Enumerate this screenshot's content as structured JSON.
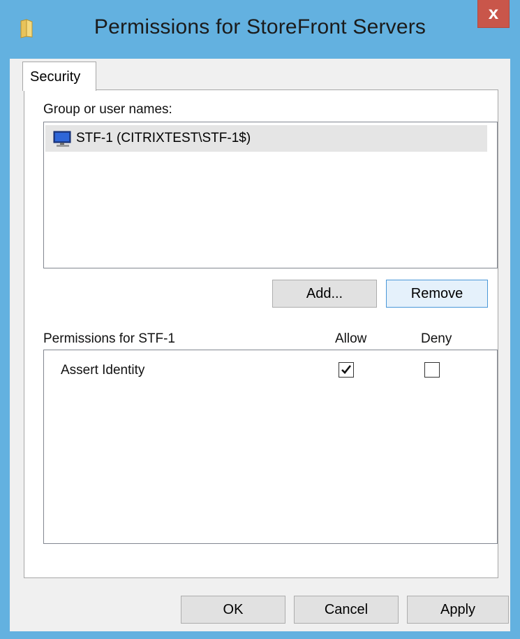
{
  "window": {
    "title": "Permissions for StoreFront Servers",
    "close_glyph": "x"
  },
  "tabs": [
    {
      "label": "Security",
      "active": true
    }
  ],
  "group_section": {
    "label": "Group or user names:",
    "items": [
      {
        "icon": "computer-icon",
        "name": "STF-1 (CITRIXTEST\\STF-1$)",
        "selected": true
      }
    ]
  },
  "group_buttons": {
    "add": "Add...",
    "remove": "Remove"
  },
  "permissions": {
    "header_label": "Permissions for STF-1",
    "allow_header": "Allow",
    "deny_header": "Deny",
    "rows": [
      {
        "name": "Assert Identity",
        "allow": true,
        "deny": false
      }
    ]
  },
  "footer_buttons": {
    "ok": "OK",
    "cancel": "Cancel",
    "apply": "Apply"
  },
  "colors": {
    "frame": "#63b1e0",
    "close_button": "#c9564a",
    "selection": "#e5e5e5"
  }
}
